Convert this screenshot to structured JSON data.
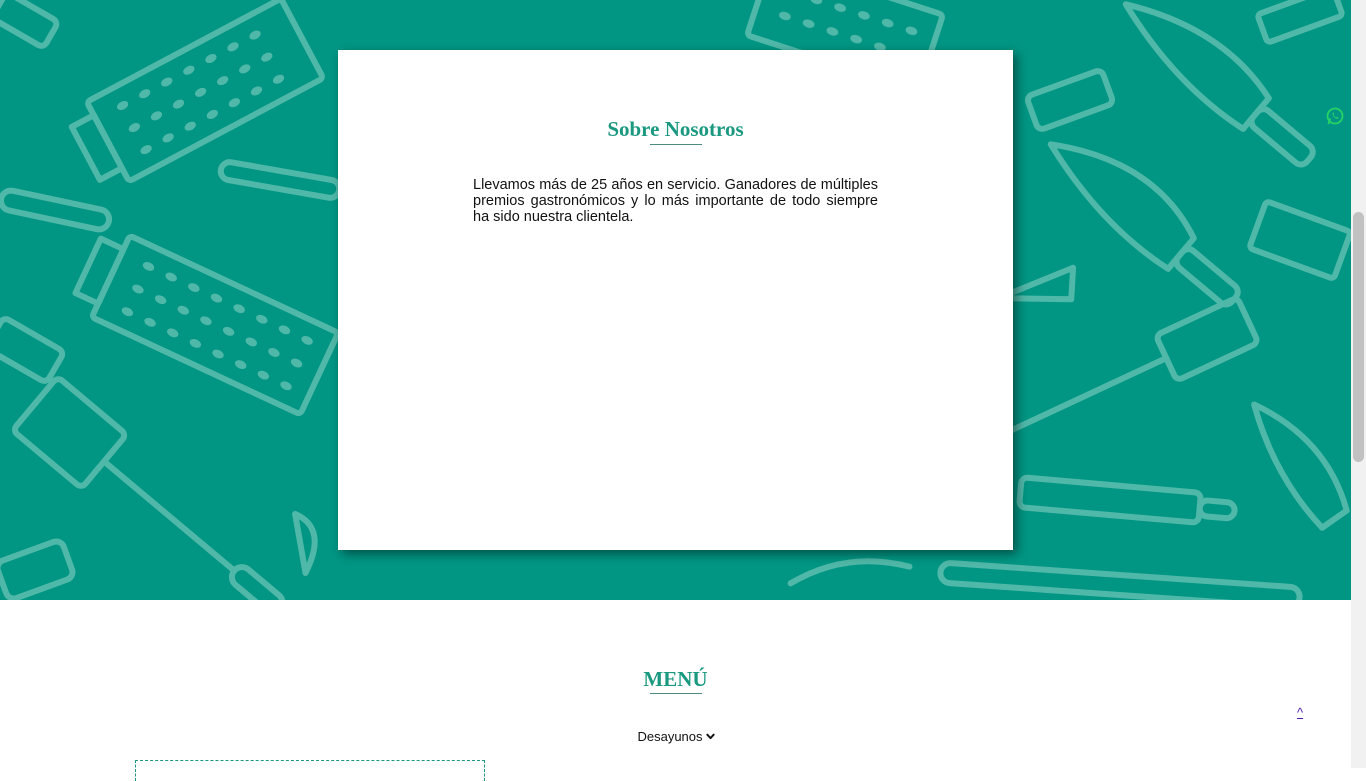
{
  "about": {
    "title": "Sobre Nosotros",
    "text": "Llevamos más de 25 años en servicio. Ganadores de múltiples premios gastronómicos y lo más importante de todo siempre ha sido nuestra clientela."
  },
  "menu": {
    "title": "MENÚ",
    "selected_option": "Desayunos"
  },
  "scroll_top_label": "^",
  "icons": {
    "whatsapp": "whatsapp-icon",
    "select_arrow": "chevron-down-icon"
  },
  "colors": {
    "hero_background": "#009683",
    "accent": "#1a9980",
    "pattern": "#5fbfaf"
  }
}
